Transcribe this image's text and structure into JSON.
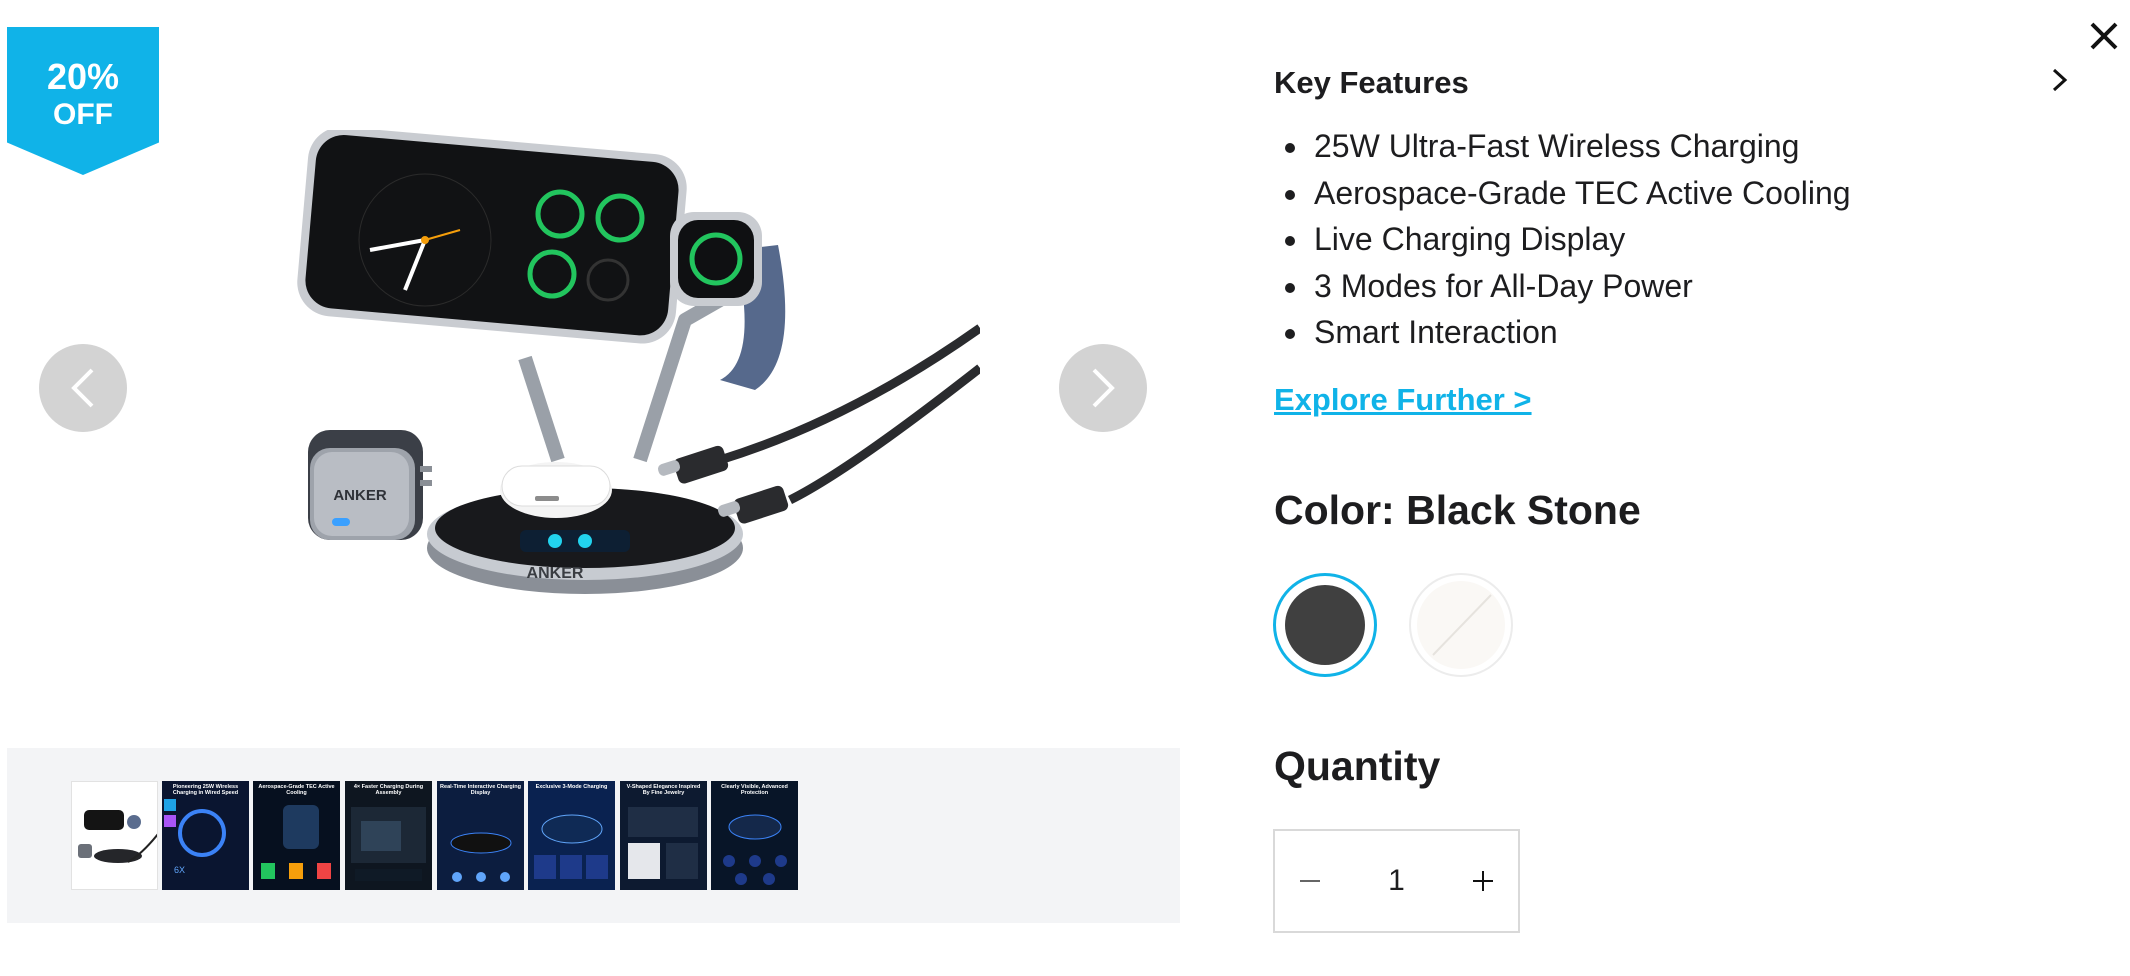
{
  "badge": {
    "percent": "20%",
    "text": "OFF"
  },
  "gallery": {
    "thumbnails": [
      {
        "caption": ""
      },
      {
        "caption": "Pioneering 25W Wireless Charging in Wired Speed"
      },
      {
        "caption": "Aerospace-Grade TEC Active Cooling"
      },
      {
        "caption": "4× Faster Charging During Assembly"
      },
      {
        "caption": "Real-Time Interactive Charging Display"
      },
      {
        "caption": "Exclusive 3-Mode Charging"
      },
      {
        "caption": "V-Shaped Elegance Inspired By Fine Jewelry"
      },
      {
        "caption": "Clearly Visible, Advanced Protection"
      }
    ]
  },
  "key_features": {
    "title": "Key Features",
    "items": [
      "25W Ultra-Fast Wireless Charging",
      "Aerospace-Grade TEC Active Cooling",
      "Live Charging Display",
      "3 Modes for All-Day Power",
      "Smart Interaction"
    ],
    "explore_link": "Explore Further >"
  },
  "color": {
    "label": "Color: Black Stone",
    "options": [
      {
        "name": "Black Stone",
        "hex": "#404040",
        "selected": true
      },
      {
        "name": "White",
        "hex": "#faf8f5",
        "selected": false
      }
    ]
  },
  "quantity": {
    "label": "Quantity",
    "value": "1"
  },
  "colors": {
    "accent": "#10b3e8",
    "strip_bg": "#f3f4f6",
    "arrow_bg": "#d3d3d3"
  }
}
